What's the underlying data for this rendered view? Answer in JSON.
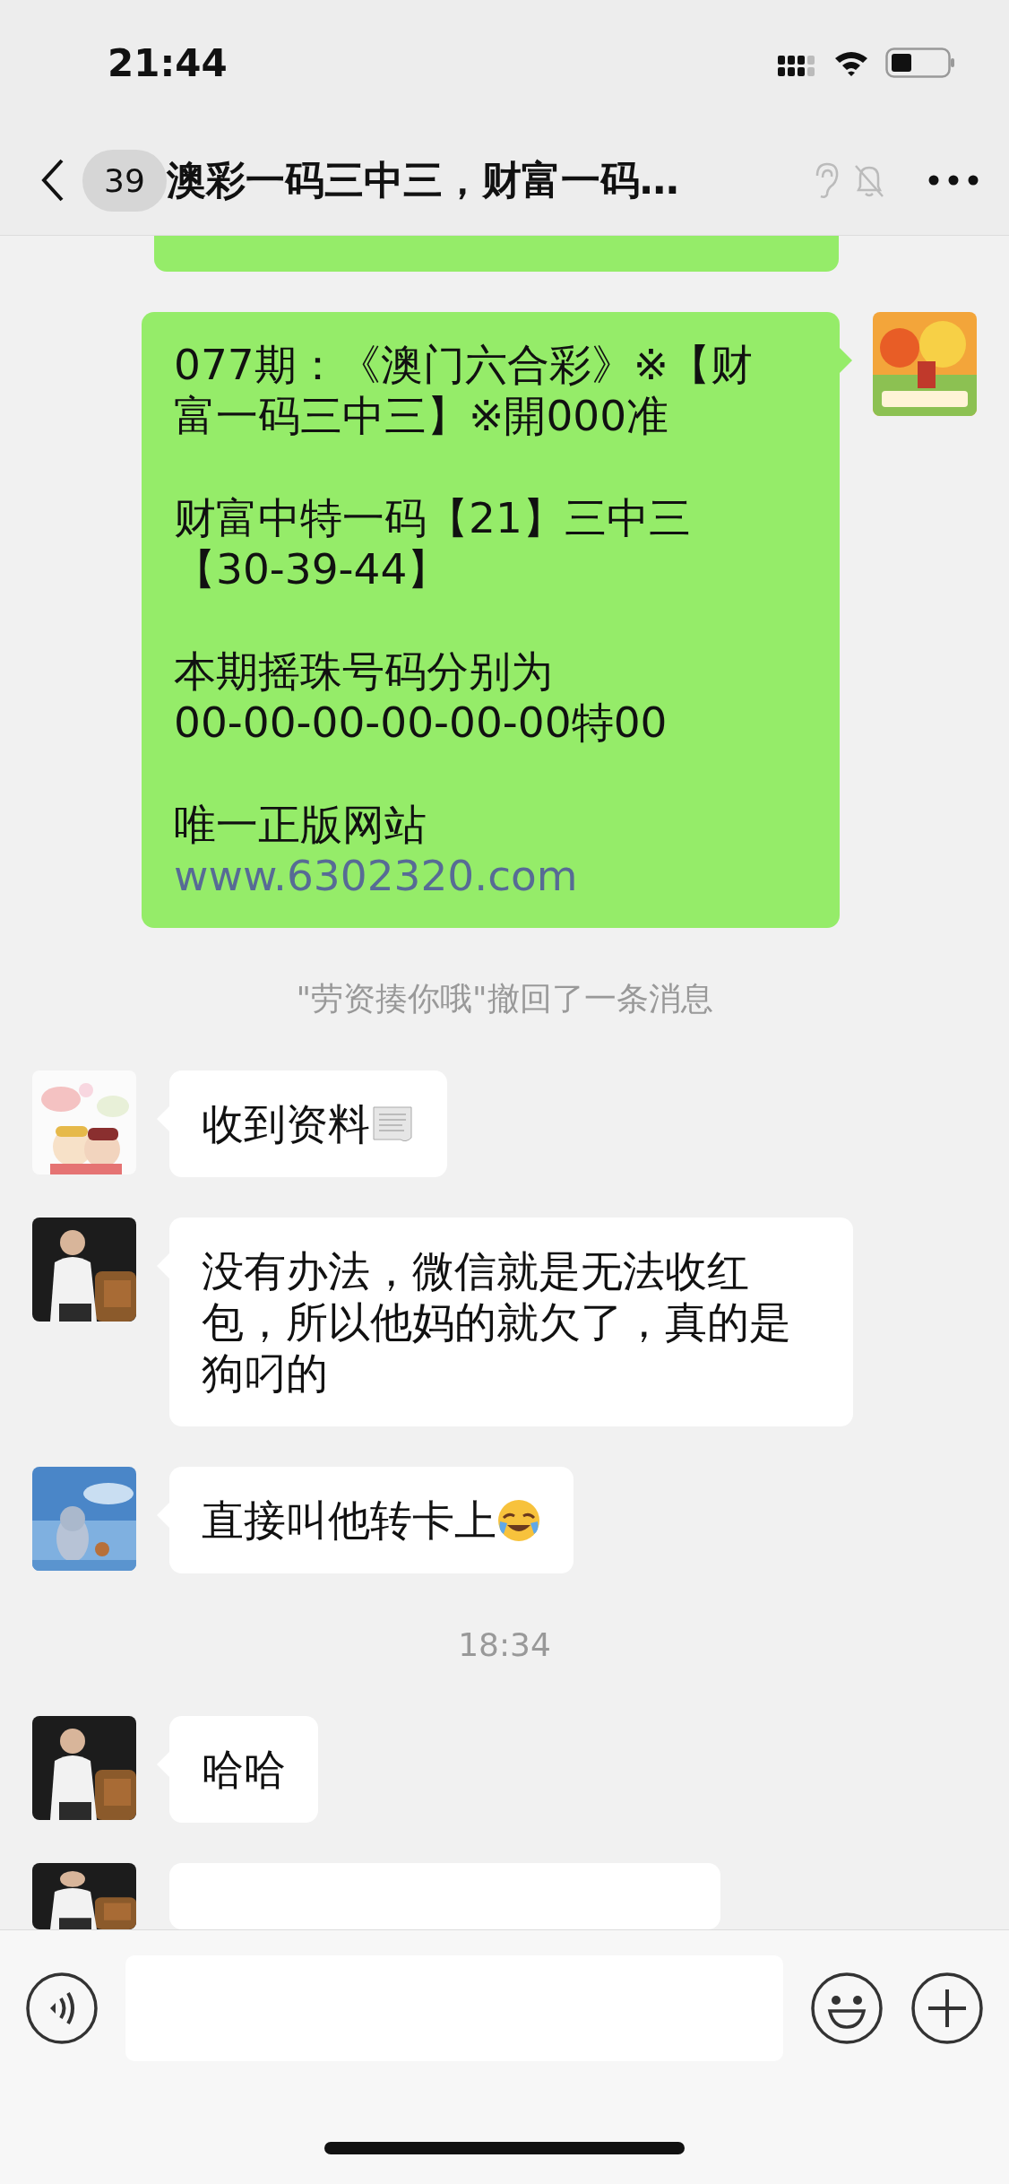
{
  "status_bar": {
    "time": "21:44"
  },
  "header": {
    "unread_count": "39",
    "title": "澳彩一码三中三，财富一码…",
    "muted": true
  },
  "messages": [
    {
      "kind": "sent"
    },
    {
      "kind": "sent",
      "paragraphs": [
        [
          {
            "kind": "text",
            "text": "077期：《澳门六合彩》※【财"
          },
          {
            "kind": "text",
            "text": "富一码三中三】※開000准"
          }
        ],
        [
          {
            "kind": "text",
            "text": "财富中特一码【21】三中三"
          },
          {
            "kind": "text",
            "text": "【30-39-44】"
          }
        ],
        [
          {
            "kind": "text",
            "text": "本期摇珠号码分别为"
          },
          {
            "kind": "text",
            "text": "00-00-00-00-00-00特00"
          }
        ],
        [
          {
            "kind": "text",
            "text": "唯一正版网站"
          },
          {
            "kind": "link",
            "text": "www.6302320.com"
          }
        ]
      ]
    },
    {
      "kind": "system",
      "text": "\"劳资揍你哦\"撤回了一条消息"
    },
    {
      "kind": "received",
      "text": "收到资料",
      "icon": {
        "kind": "document"
      }
    },
    {
      "kind": "received",
      "text": "没有办法，微信就是无法收红包，所以他妈的就欠了，真的是狗叼的"
    },
    {
      "kind": "received",
      "text": "直接叫他转卡上",
      "icon": {
        "kind": "crying-laughing"
      }
    },
    {
      "kind": "time",
      "text": "18:34"
    },
    {
      "kind": "received",
      "text": "哈哈"
    },
    {
      "kind": "received"
    }
  ]
}
